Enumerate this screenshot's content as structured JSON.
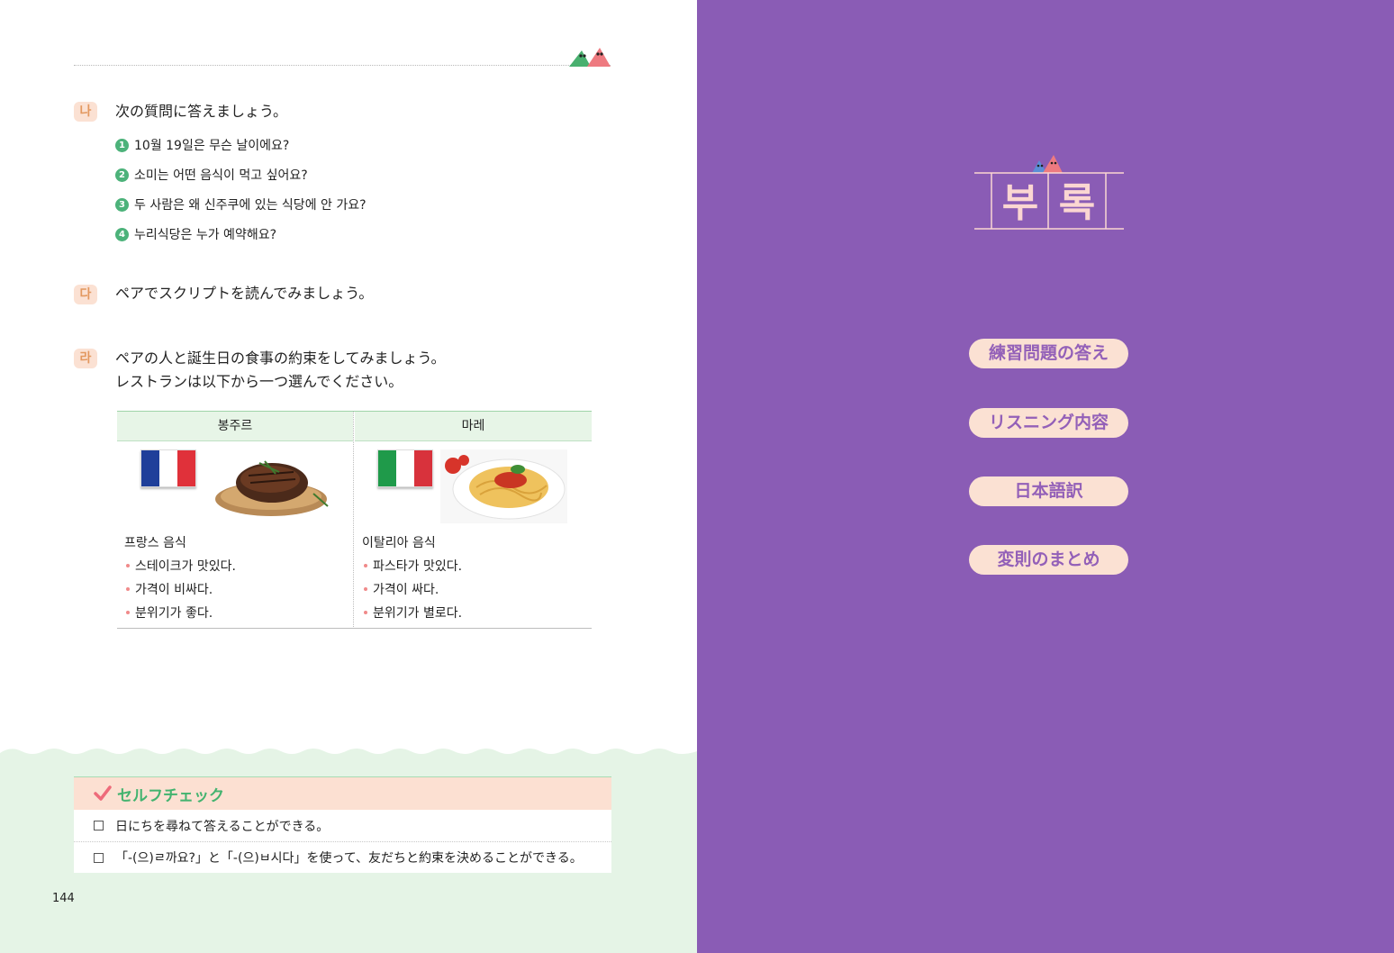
{
  "left_page": {
    "sections": [
      {
        "badge": "나",
        "title": "次の質問に答えましょう。",
        "questions": [
          {
            "num": "1",
            "text": "10월 19일은 무슨 날이에요?"
          },
          {
            "num": "2",
            "text": "소미는 어떤 음식이 먹고 싶어요?"
          },
          {
            "num": "3",
            "text": "두 사람은 왜 신주쿠에 있는 식당에 안 가요?"
          },
          {
            "num": "4",
            "text": "누리식당은 누가 예약해요?"
          }
        ]
      },
      {
        "badge": "다",
        "title": "ペアでスクリプトを読んでみましょう。"
      },
      {
        "badge": "라",
        "title_line1": "ペアの人と誕生日の食事の約束をしてみましょう。",
        "title_line2": "レストランは以下から一つ選んでください。"
      }
    ],
    "restaurants": [
      {
        "name": "봉주르",
        "flag": "france-flag",
        "flag_colors": [
          "#1f3f9a",
          "#ffffff",
          "#e0313a"
        ],
        "cuisine": "프랑스 음식",
        "features": [
          "스테이크가 맛있다.",
          "가격이 비싸다.",
          "분위기가 좋다."
        ]
      },
      {
        "name": "마레",
        "flag": "italy-flag",
        "flag_colors": [
          "#1f9a4a",
          "#ffffff",
          "#d8323c"
        ],
        "cuisine": "이탈리아 음식",
        "features": [
          "파스타가 맛있다.",
          "가격이 싸다.",
          "분위기가 별로다."
        ]
      }
    ],
    "self_check": {
      "title": "セルフチェック",
      "items": [
        "日にちを尋ねて答えることができる。",
        "「-(으)ㄹ까요?」と「-(으)ㅂ시다」を使って、友だちと約束を決めることができる。"
      ]
    },
    "page_number": "144"
  },
  "right_page": {
    "logo_chars": [
      "부",
      "록"
    ],
    "menu_items": [
      "練習問題の答え",
      "リスニング内容",
      "日本語訳",
      "変則のまとめ"
    ]
  },
  "colors": {
    "accent_green": "#4cb27a",
    "badge_bg": "#fbe1d3",
    "badge_text": "#e3985f",
    "band_green": "#e5f4e6",
    "right_page_bg": "#8a5cb5",
    "menu_text": "#9360b8",
    "logo_pink": "#fbd6d2"
  }
}
